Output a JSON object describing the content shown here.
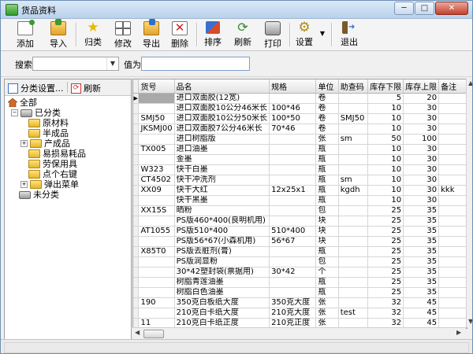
{
  "window": {
    "title": "货品资料",
    "min_label": "─",
    "max_label": "□",
    "close_label": "✕"
  },
  "toolbar": {
    "add": "添加",
    "import": "导入",
    "categorize": "归类",
    "edit": "修改",
    "export": "导出",
    "delete": "删除",
    "sort": "排序",
    "refresh": "刷新",
    "print": "打印",
    "settings": "设置",
    "exit": "退出"
  },
  "search": {
    "label": "搜索",
    "field_value": "",
    "value_label": "值为",
    "value_input": ""
  },
  "sidebar": {
    "classify_settings": "分类设置...",
    "refresh": "刷新",
    "tree": {
      "all": "全部",
      "categorized": "已分类",
      "children": [
        "原材料",
        "半成品",
        "产成品",
        "易损易耗品",
        "劳保用具",
        "点个右键",
        "弹出菜单"
      ],
      "uncategorized": "未分类"
    }
  },
  "grid": {
    "columns": [
      "货号",
      "品名",
      "规格",
      "单位",
      "助查码",
      "库存下限",
      "库存上限",
      "备注"
    ],
    "rows": [
      [
        "",
        "进口双面胶(12宽)",
        "",
        "卷",
        "",
        "5",
        "20",
        ""
      ],
      [
        "",
        "进口双面胶10公分46米长",
        "100*46",
        "卷",
        "",
        "10",
        "30",
        ""
      ],
      [
        "SMJ50",
        "进口双面胶10公分50米长",
        "100*50",
        "卷",
        "SMJ50",
        "10",
        "30",
        ""
      ],
      [
        "JKSMJ00",
        "进口双面胶7公分46米长",
        "70*46",
        "卷",
        "",
        "10",
        "30",
        ""
      ],
      [
        "",
        "进口树脂版",
        "",
        "张",
        "sm",
        "50",
        "100",
        ""
      ],
      [
        "TX005",
        "进口油墨",
        "",
        "瓶",
        "",
        "10",
        "30",
        ""
      ],
      [
        "",
        "金墨",
        "",
        "瓶",
        "",
        "10",
        "30",
        ""
      ],
      [
        "W323",
        "快干白墨",
        "",
        "瓶",
        "",
        "10",
        "30",
        ""
      ],
      [
        "CT4502",
        "快干冲洗剂",
        "",
        "瓶",
        "sm",
        "10",
        "30",
        ""
      ],
      [
        "XX09",
        "快干大红",
        "12x25x1",
        "瓶",
        "kgdh",
        "10",
        "30",
        "kkk"
      ],
      [
        "",
        "快干黑墨",
        "",
        "瓶",
        "",
        "10",
        "30",
        ""
      ],
      [
        "XX15S",
        "晒粉",
        "",
        "包",
        "",
        "25",
        "35",
        ""
      ],
      [
        "",
        "PS版460*400(良明机用)",
        "",
        "块",
        "",
        "25",
        "35",
        ""
      ],
      [
        "AT1055",
        "PS版510*400",
        "510*400",
        "块",
        "",
        "25",
        "35",
        ""
      ],
      [
        "",
        "PS版56*67(小森机用)",
        "56*67",
        "块",
        "",
        "25",
        "35",
        ""
      ],
      [
        "X85T0",
        "PS版去脏剂(膏)",
        "",
        "瓶",
        "",
        "25",
        "35",
        ""
      ],
      [
        "",
        "PS版润显粉",
        "",
        "包",
        "",
        "25",
        "35",
        ""
      ],
      [
        "",
        "30*42塑封袋(票据用)",
        "30*42",
        "个",
        "",
        "25",
        "35",
        ""
      ],
      [
        "",
        "树脂青莲油墨",
        "",
        "瓶",
        "",
        "25",
        "35",
        ""
      ],
      [
        "",
        "树脂白色油墨",
        "",
        "瓶",
        "",
        "25",
        "35",
        ""
      ],
      [
        "190",
        "350克白板纸大度",
        "350克大度",
        "张",
        "",
        "32",
        "45",
        ""
      ],
      [
        "",
        "210克白卡纸大度",
        "210克大度",
        "张",
        "test",
        "32",
        "45",
        ""
      ],
      [
        "11",
        "210克白卡纸正度",
        "210克正度",
        "张",
        "",
        "32",
        "45",
        ""
      ]
    ]
  }
}
